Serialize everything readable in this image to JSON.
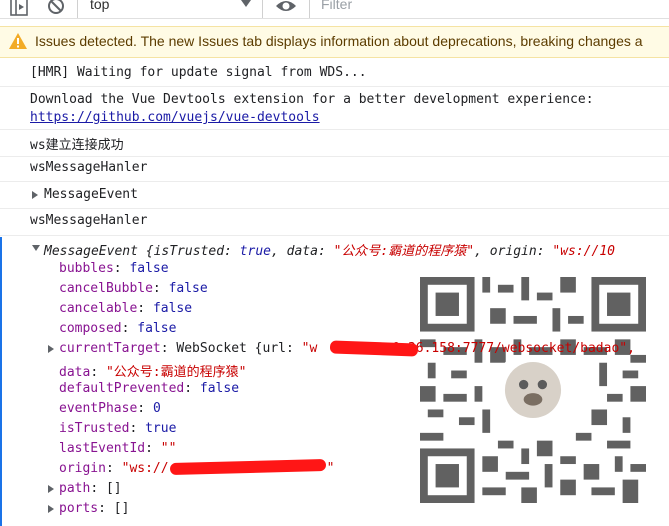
{
  "toolbar": {
    "context": "top",
    "filter_placeholder": "Filter",
    "icons": [
      "sidebar-toggle-icon",
      "clear-console-icon",
      "chevron-down-icon",
      "eye-icon"
    ]
  },
  "issues_bar": {
    "text": "Issues detected. The new Issues tab displays information about deprecations, breaking changes a",
    "icon": "warning-icon"
  },
  "logs": [
    {
      "text": "[HMR] Waiting for update signal from WDS..."
    },
    {
      "text": "Download the Vue Devtools extension for a better development experience:",
      "link": "https://github.com/vuejs/vue-devtools"
    },
    {
      "text": "ws建立连接成功"
    },
    {
      "text": "wsMessageHanler"
    },
    {
      "text": "MessageEvent"
    },
    {
      "text": "wsMessageHanler"
    }
  ],
  "message_event": {
    "header_name": "MessageEvent",
    "header_rest_1": " {isTrusted: ",
    "header_true": "true",
    "header_rest_2": ", data: ",
    "header_data": "\"公众号:霸道的程序猿\"",
    "header_rest_3": ", origin: ",
    "header_origin": "\"ws://10",
    "props": {
      "bubbles": {
        "key": "bubbles",
        "value": "false"
      },
      "cancelBubble": {
        "key": "cancelBubble",
        "value": "false"
      },
      "cancelable": {
        "key": "cancelable",
        "value": "false"
      },
      "composed": {
        "key": "composed",
        "value": "false"
      },
      "currentTarget": {
        "key": "currentTarget",
        "value_type": "WebSocket {url: ",
        "value_str_a": "\"w",
        "value_str_b": "0.36.158:7777/websocket/badao\","
      },
      "data": {
        "key": "data",
        "value": "\"公众号:霸道的程序猿\""
      },
      "defaultPrevented": {
        "key": "defaultPrevented",
        "value": "false"
      },
      "eventPhase": {
        "key": "eventPhase",
        "value": "0"
      },
      "isTrusted": {
        "key": "isTrusted",
        "value": "true"
      },
      "lastEventId": {
        "key": "lastEventId",
        "value": "\"\""
      },
      "origin": {
        "key": "origin",
        "value_a": "\"ws://",
        "value_b": "\""
      },
      "path": {
        "key": "path",
        "value": "[]"
      },
      "ports": {
        "key": "ports",
        "value": "[]"
      }
    }
  },
  "colors": {
    "key": "#881391",
    "keyword": "#1a1aa6",
    "string": "#c80000",
    "redaction": "#ff1616",
    "warning": "#f2ab26",
    "selection": "#1a73e8"
  }
}
